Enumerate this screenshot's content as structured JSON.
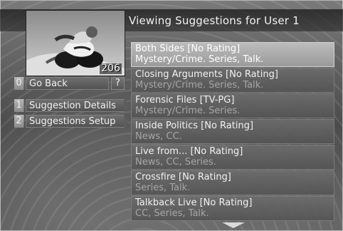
{
  "header": {
    "title": "Viewing Suggestions for User 1"
  },
  "preview": {
    "channel_number": "206"
  },
  "menu": [
    {
      "index": "0",
      "label": "Go Back"
    },
    {
      "index": "1",
      "label": "Suggestion Details"
    },
    {
      "index": "2",
      "label": "Suggestions Setup"
    }
  ],
  "help": {
    "label": "?"
  },
  "suggestions": [
    {
      "title": "Both Sides [No Rating]",
      "subtitle": "Mystery/Crime. Series, Talk."
    },
    {
      "title": "Closing Arguments [No Rating]",
      "subtitle": "Mystery/Crime. Series, Talk."
    },
    {
      "title": "Forensic Files [TV-PG]",
      "subtitle": "Mystery/Crime. Series."
    },
    {
      "title": "Inside Politics [No Rating]",
      "subtitle": "News, CC."
    },
    {
      "title": "Live from... [No Rating]",
      "subtitle": "News, CC, Series."
    },
    {
      "title": "Crossfire [No Rating]",
      "subtitle": "Series, Talk."
    },
    {
      "title": "Talkback Live [No Rating]",
      "subtitle": "CC, Series, Talk."
    }
  ],
  "icons": {
    "scroll_down": "down-arrow-icon"
  },
  "colors": {
    "selected_item": "#bcbcbc",
    "panel": "#5f5f5f",
    "text": "#f2f2f2",
    "subtext": "#a6a6a6"
  }
}
